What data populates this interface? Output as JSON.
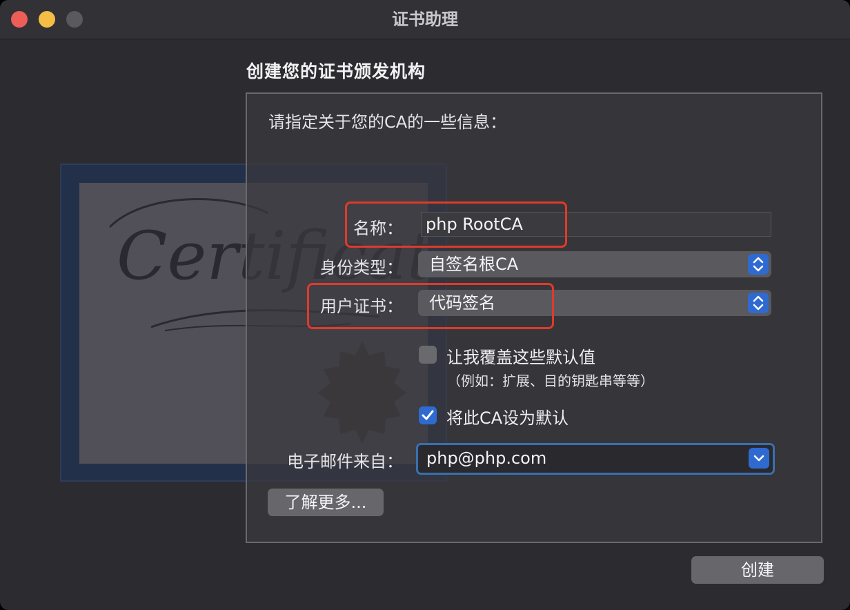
{
  "window": {
    "title": "证书助理"
  },
  "page": {
    "heading": "创建您的证书颁发机构",
    "intro": "请指定关于您的CA的一些信息："
  },
  "form": {
    "name_label": "名称：",
    "name_value": "php RootCA",
    "identity_type_label": "身份类型：",
    "identity_type_value": "自签名根CA",
    "user_cert_label": "用户证书：",
    "user_cert_value": "代码签名",
    "override_label": "让我覆盖这些默认值",
    "override_note": "（例如：扩展、目的钥匙串等等）",
    "override_checked": false,
    "default_label": "将此CA设为默认",
    "default_checked": true,
    "email_label": "电子邮件来自：",
    "email_value": "php@php.com"
  },
  "buttons": {
    "learn_more": "了解更多...",
    "create": "创建"
  },
  "illustration": {
    "script_text": "Certificate"
  },
  "colors": {
    "accent": "#2f6ad0",
    "annotation": "#e03a2a"
  }
}
